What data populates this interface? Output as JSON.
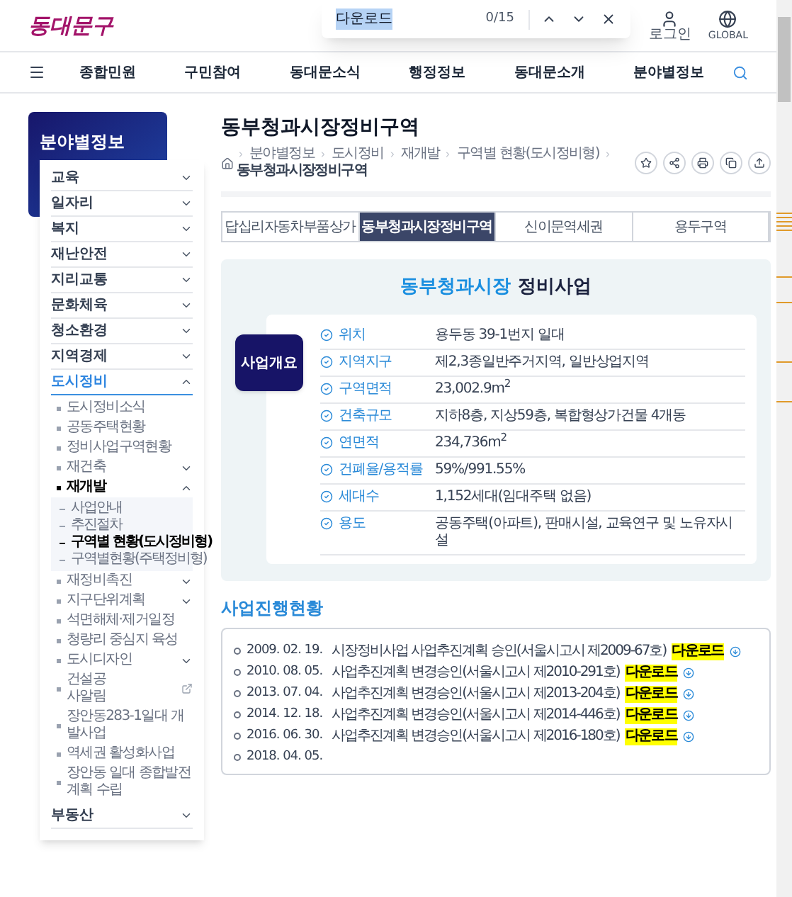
{
  "find_bar": {
    "query": "다운로드",
    "count": "0/15"
  },
  "header": {
    "logo": "동대문구",
    "login": "로그인",
    "global": "GLOBAL"
  },
  "nav": {
    "items": [
      "종합민원",
      "구민참여",
      "동대문소식",
      "행정정보",
      "동대문소개",
      "분야별정보"
    ]
  },
  "sidebar": {
    "title": "분야별정보",
    "items": [
      {
        "label": "교육",
        "expanded": false,
        "selected": false
      },
      {
        "label": "일자리",
        "expanded": false,
        "selected": false
      },
      {
        "label": "복지",
        "expanded": false,
        "selected": false
      },
      {
        "label": "재난안전",
        "expanded": false,
        "selected": false
      },
      {
        "label": "지리교통",
        "expanded": false,
        "selected": false
      },
      {
        "label": "문화체육",
        "expanded": false,
        "selected": false
      },
      {
        "label": "청소환경",
        "expanded": false,
        "selected": false
      },
      {
        "label": "지역경제",
        "expanded": false,
        "selected": false
      },
      {
        "label": "도시정비",
        "expanded": true,
        "selected": true,
        "children": [
          {
            "kind": "link",
            "label": "도시정비소식",
            "selected": false
          },
          {
            "kind": "link",
            "label": "공동주택현황",
            "selected": false
          },
          {
            "kind": "link",
            "label": "정비사업구역현황",
            "selected": false
          },
          {
            "kind": "folder",
            "label": "재건축",
            "expanded": false,
            "selected": false
          },
          {
            "kind": "folder",
            "label": "재개발",
            "expanded": true,
            "selected": true,
            "children": [
              {
                "label": "사업안내",
                "selected": false
              },
              {
                "label": "추진절차",
                "selected": false
              },
              {
                "label": "구역별 현황(도시정비형)",
                "selected": true
              },
              {
                "label": "구역별현황(주택정비형)",
                "selected": false
              }
            ]
          },
          {
            "kind": "folder",
            "label": "재정비촉진",
            "expanded": false,
            "selected": false
          },
          {
            "kind": "folder",
            "label": "지구단위계획",
            "expanded": false,
            "selected": false
          },
          {
            "kind": "link",
            "label": "석면해체·제거일정",
            "selected": false
          },
          {
            "kind": "link",
            "label": "청량리 중심지 육성",
            "selected": false
          },
          {
            "kind": "folder",
            "label": "도시디자인",
            "expanded": false,
            "selected": false
          },
          {
            "kind": "external",
            "label": "건설공사알림",
            "selected": false
          },
          {
            "kind": "link",
            "label": "장안동283-1일대 개발사업",
            "selected": false
          },
          {
            "kind": "link",
            "label": "역세권 활성화사업",
            "selected": false
          },
          {
            "kind": "link",
            "label": "장안동 일대 종합발전계획 수립",
            "selected": false
          }
        ]
      },
      {
        "label": "부동산",
        "expanded": false,
        "selected": false
      }
    ]
  },
  "page": {
    "title": "동부청과시장정비구역",
    "breadcrumb": [
      "분야별정보",
      "도시정비",
      "재개발",
      "구역별 현황(도시정비형)",
      "동부청과시장정비구역"
    ]
  },
  "tabs": [
    {
      "label": "답십리자동차부품상가",
      "selected": false
    },
    {
      "label": "동부청과시장정비구역",
      "selected": true
    },
    {
      "label": "신이문역세권",
      "selected": false
    },
    {
      "label": "용두구역",
      "selected": false
    }
  ],
  "overview": {
    "heading_highlight": "동부청과시장",
    "heading_rest": "정비사업",
    "badge": "사업개요",
    "rows": [
      {
        "label": "위치",
        "value": "용두동 39-1번지 일대"
      },
      {
        "label": "지역지구",
        "value": "제2,3종일반주거지역, 일반상업지역"
      },
      {
        "label": "구역면적",
        "value": "23,002.9m$^{2}$"
      },
      {
        "label": "건축규모",
        "value": "지하8층, 지상59층, 복합형상가건물 4개동"
      },
      {
        "label": "연면적",
        "value": "234,736m$^{2}$"
      },
      {
        "label": "건폐율/용적률",
        "value": "59%/991.55%"
      },
      {
        "label": "세대수",
        "value": "1,152세대(임대주택 없음)"
      },
      {
        "label": "용도",
        "value": "공동주택(아파트), 판매시설, 교육연구 및 노유자시설"
      }
    ]
  },
  "progress": {
    "title": "사업진행현황",
    "items": [
      {
        "date": "2009. 02. 19.",
        "text": "시장정비사업 사업추진계획 승인(서울시고시 제2009-67호)",
        "download": "다운로드"
      },
      {
        "date": "2010. 08. 05.",
        "text": "사업추진계획 변경승인(서울시고시 제2010-291호)",
        "download": "다운로드"
      },
      {
        "date": "2013. 07. 04.",
        "text": "사업추진계획 변경승인(서울시고시 제2013-204호)",
        "download": "다운로드"
      },
      {
        "date": "2014. 12. 18.",
        "text": "사업추진계획 변경승인(서울시고시 제2014-446호)",
        "download": "다운로드"
      },
      {
        "date": "2016. 06. 30.",
        "text": "사업추진계획 변경승인(서울시고시 제2016-180호)",
        "download": "다운로드"
      },
      {
        "date": "2018. 04. 05."
      }
    ]
  }
}
